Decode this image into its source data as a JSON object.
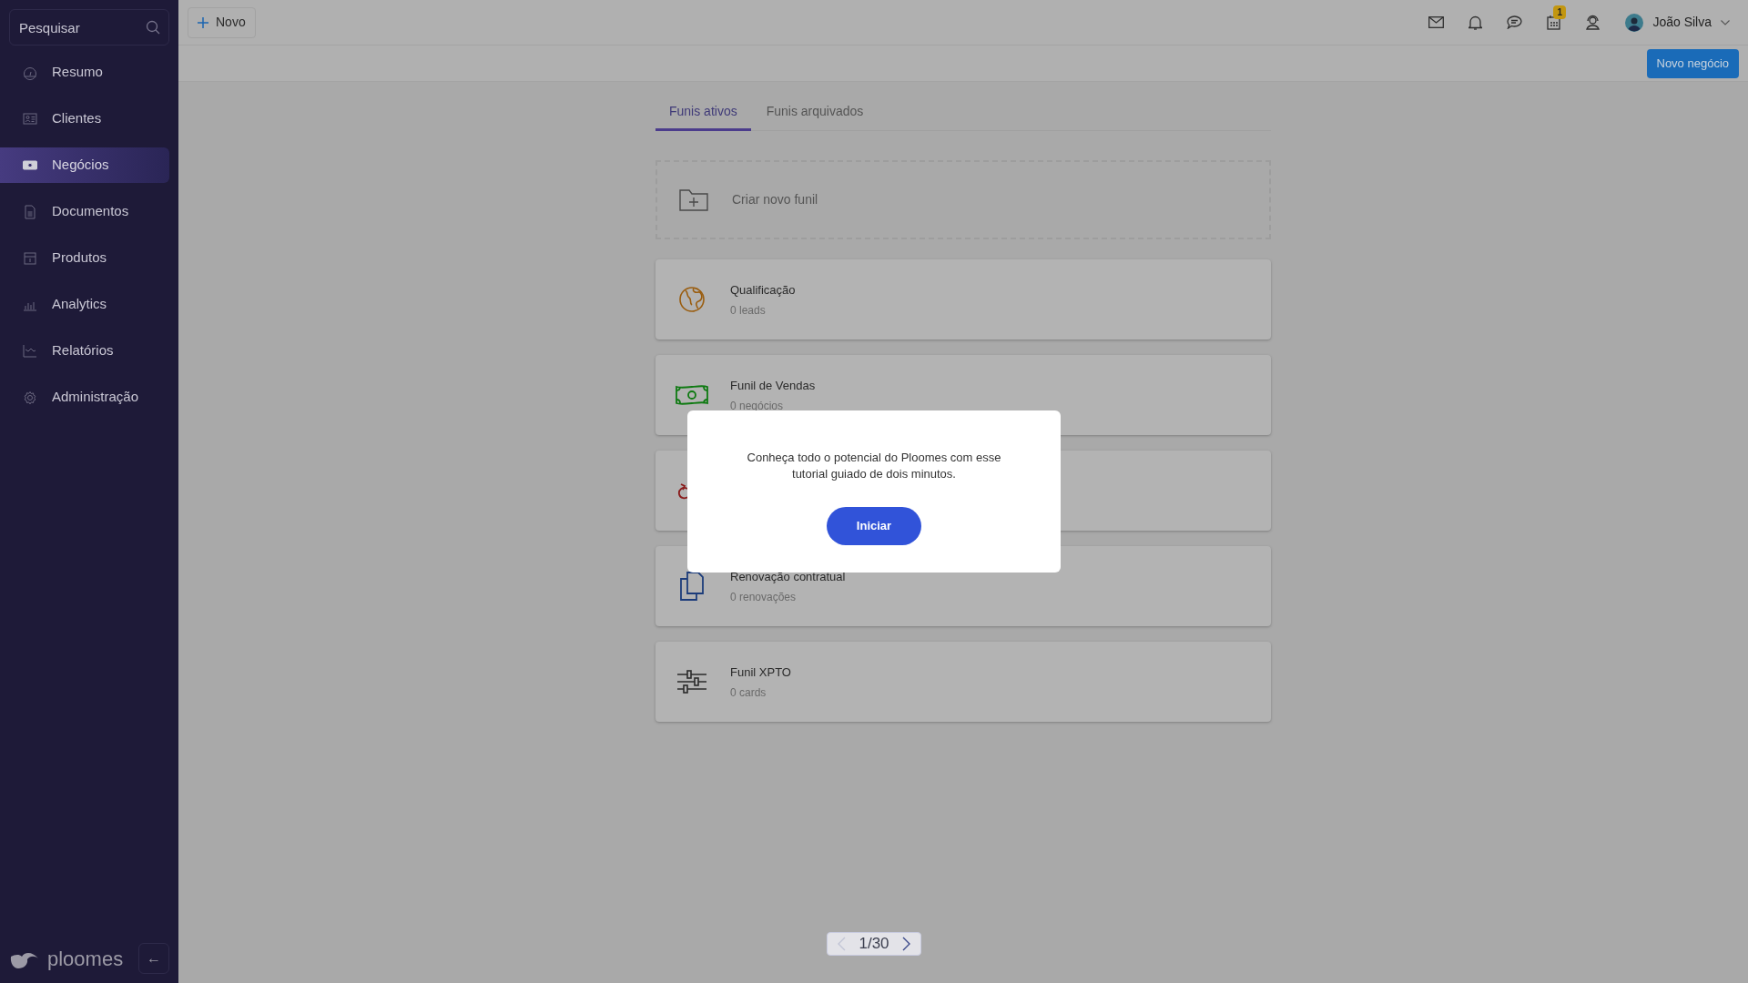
{
  "sidebar": {
    "search": {
      "placeholder": "Pesquisar"
    },
    "items": [
      {
        "label": "Resumo",
        "selected": false
      },
      {
        "label": "Clientes",
        "selected": false
      },
      {
        "label": "Negócios",
        "selected": true
      },
      {
        "label": "Documentos",
        "selected": false
      },
      {
        "label": "Produtos",
        "selected": false
      },
      {
        "label": "Analytics",
        "selected": false
      },
      {
        "label": "Relatórios",
        "selected": false
      },
      {
        "label": "Administração",
        "selected": false
      }
    ],
    "logo": "ploomes",
    "collapse_button": "←"
  },
  "top_bar": {
    "new_button": "Novo",
    "calendar_badge": "1",
    "user": "João Silva"
  },
  "action_button": "Novo negócio",
  "tabs": [
    {
      "label": "Funis ativos",
      "selected": true
    },
    {
      "label": "Funis arquivados",
      "selected": false
    }
  ],
  "create_funnel": "Criar novo funil",
  "funnels": [
    {
      "kind": "globe",
      "title": "Qualificação",
      "subtitle": "0 leads"
    },
    {
      "kind": "money",
      "title": "Funil de Vendas",
      "subtitle": "0 negócios"
    },
    {
      "kind": "cycle"
    },
    {
      "kind": "copies",
      "title": "Renovação contratual",
      "subtitle": "0 renovações"
    },
    {
      "kind": "sliders",
      "title": "Funil XPTO",
      "subtitle": "0 cards"
    }
  ],
  "modal": {
    "text": "Conheça todo o potencial do Ploomes com esse tutorial guiado de dois minutos.",
    "button": "Iniciar"
  },
  "pager": {
    "text": "1/30"
  }
}
